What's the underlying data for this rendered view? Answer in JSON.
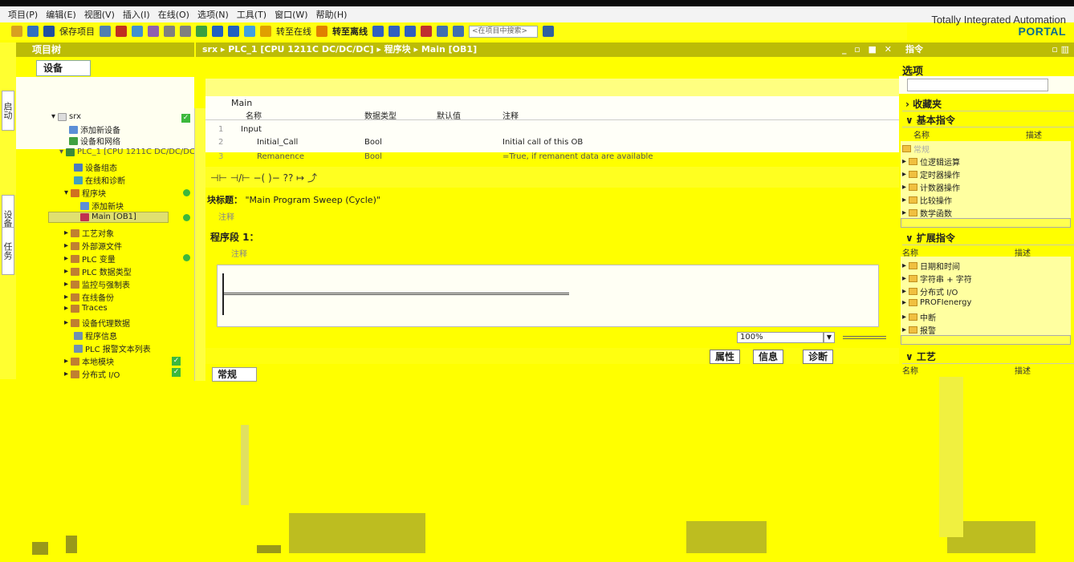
{
  "menu": [
    "项目(P)",
    "编辑(E)",
    "视图(V)",
    "插入(I)",
    "在线(O)",
    "选项(N)",
    "工具(T)",
    "窗口(W)",
    "帮助(H)"
  ],
  "brand": {
    "line1": "Totally Integrated Automation",
    "line2": "PORTAL"
  },
  "toolbar": {
    "save_label": "保存项目",
    "go_online": "转至在线",
    "go_offline": "转至离线",
    "search_placeholder": "<在项目中搜索>"
  },
  "project_tree": {
    "title": "项目树",
    "devices_tab": "设备",
    "vtabs": [
      "启动",
      "设备",
      "任务"
    ],
    "items": [
      {
        "label": "srx",
        "indent": 0
      },
      {
        "label": "添加新设备",
        "indent": 1
      },
      {
        "label": "设备和网络",
        "indent": 1
      },
      {
        "label": "PLC_1 [CPU 1211C DC/DC/DC]",
        "indent": 1
      },
      {
        "label": "设备组态",
        "indent": 2
      },
      {
        "label": "在线和诊断",
        "indent": 2
      },
      {
        "label": "程序块",
        "indent": 2
      },
      {
        "label": "添加新块",
        "indent": 3
      },
      {
        "label": "Main [OB1]",
        "indent": 3
      },
      {
        "label": "工艺对象",
        "indent": 2
      },
      {
        "label": "外部源文件",
        "indent": 2
      },
      {
        "label": "PLC 变量",
        "indent": 2
      },
      {
        "label": "PLC 数据类型",
        "indent": 2
      },
      {
        "label": "监控与强制表",
        "indent": 2
      },
      {
        "label": "在线备份",
        "indent": 2
      },
      {
        "label": "Traces",
        "indent": 2
      },
      {
        "label": "设备代理数据",
        "indent": 2
      },
      {
        "label": "程序信息",
        "indent": 2
      },
      {
        "label": "PLC 报警文本列表",
        "indent": 2
      },
      {
        "label": "本地模块",
        "indent": 2
      },
      {
        "label": "分布式 I/O",
        "indent": 2
      }
    ]
  },
  "editor": {
    "breadcrumb": "srx ▸ PLC_1 [CPU 1211C DC/DC/DC] ▸ 程序块 ▸ Main [OB1]",
    "interface": {
      "block_name": "Main",
      "columns": [
        "名称",
        "数据类型",
        "默认值",
        "注释"
      ],
      "rows": [
        {
          "num": "1",
          "name": "Input",
          "type": "",
          "default": "",
          "comment": ""
        },
        {
          "num": "2",
          "name": "Initial_Call",
          "type": "Bool",
          "default": "",
          "comment": "Initial call of this OB"
        },
        {
          "num": "3",
          "name": "Remanence",
          "type": "Bool",
          "default": "",
          "comment": "=True, if remanent data are available"
        }
      ]
    },
    "ladder_icons": "⊣⊢ ⊣/⊢ −( )− ?? ↦ ⤴",
    "block_title_label": "块标题：",
    "block_title_value": "\"Main Program Sweep (Cycle)\"",
    "block_comment": "注释",
    "network_title": "程序段 1：",
    "network_comment": "注释",
    "zoom": "100%"
  },
  "inspector": {
    "tabs": [
      "属性",
      "信息",
      "诊断"
    ],
    "sub_tabs": [
      "常规"
    ]
  },
  "right_panel": {
    "header": "指令",
    "title": "选项",
    "favorites": "收藏夹",
    "basic": "基本指令",
    "basic_cols": [
      "名称",
      "描述"
    ],
    "basic_items": [
      "常规",
      "位逻辑运算",
      "定时器操作",
      "计数器操作",
      "比较操作",
      "数学函数"
    ],
    "extended": "扩展指令",
    "extended_cols": [
      "名称",
      "描述"
    ],
    "extended_items": [
      "日期和时间",
      "字符串 + 字符",
      "分布式 I/O",
      "PROFIenergy",
      "中断",
      "报警"
    ],
    "tech": "工艺",
    "tech_cols": [
      "名称",
      "描述"
    ]
  }
}
